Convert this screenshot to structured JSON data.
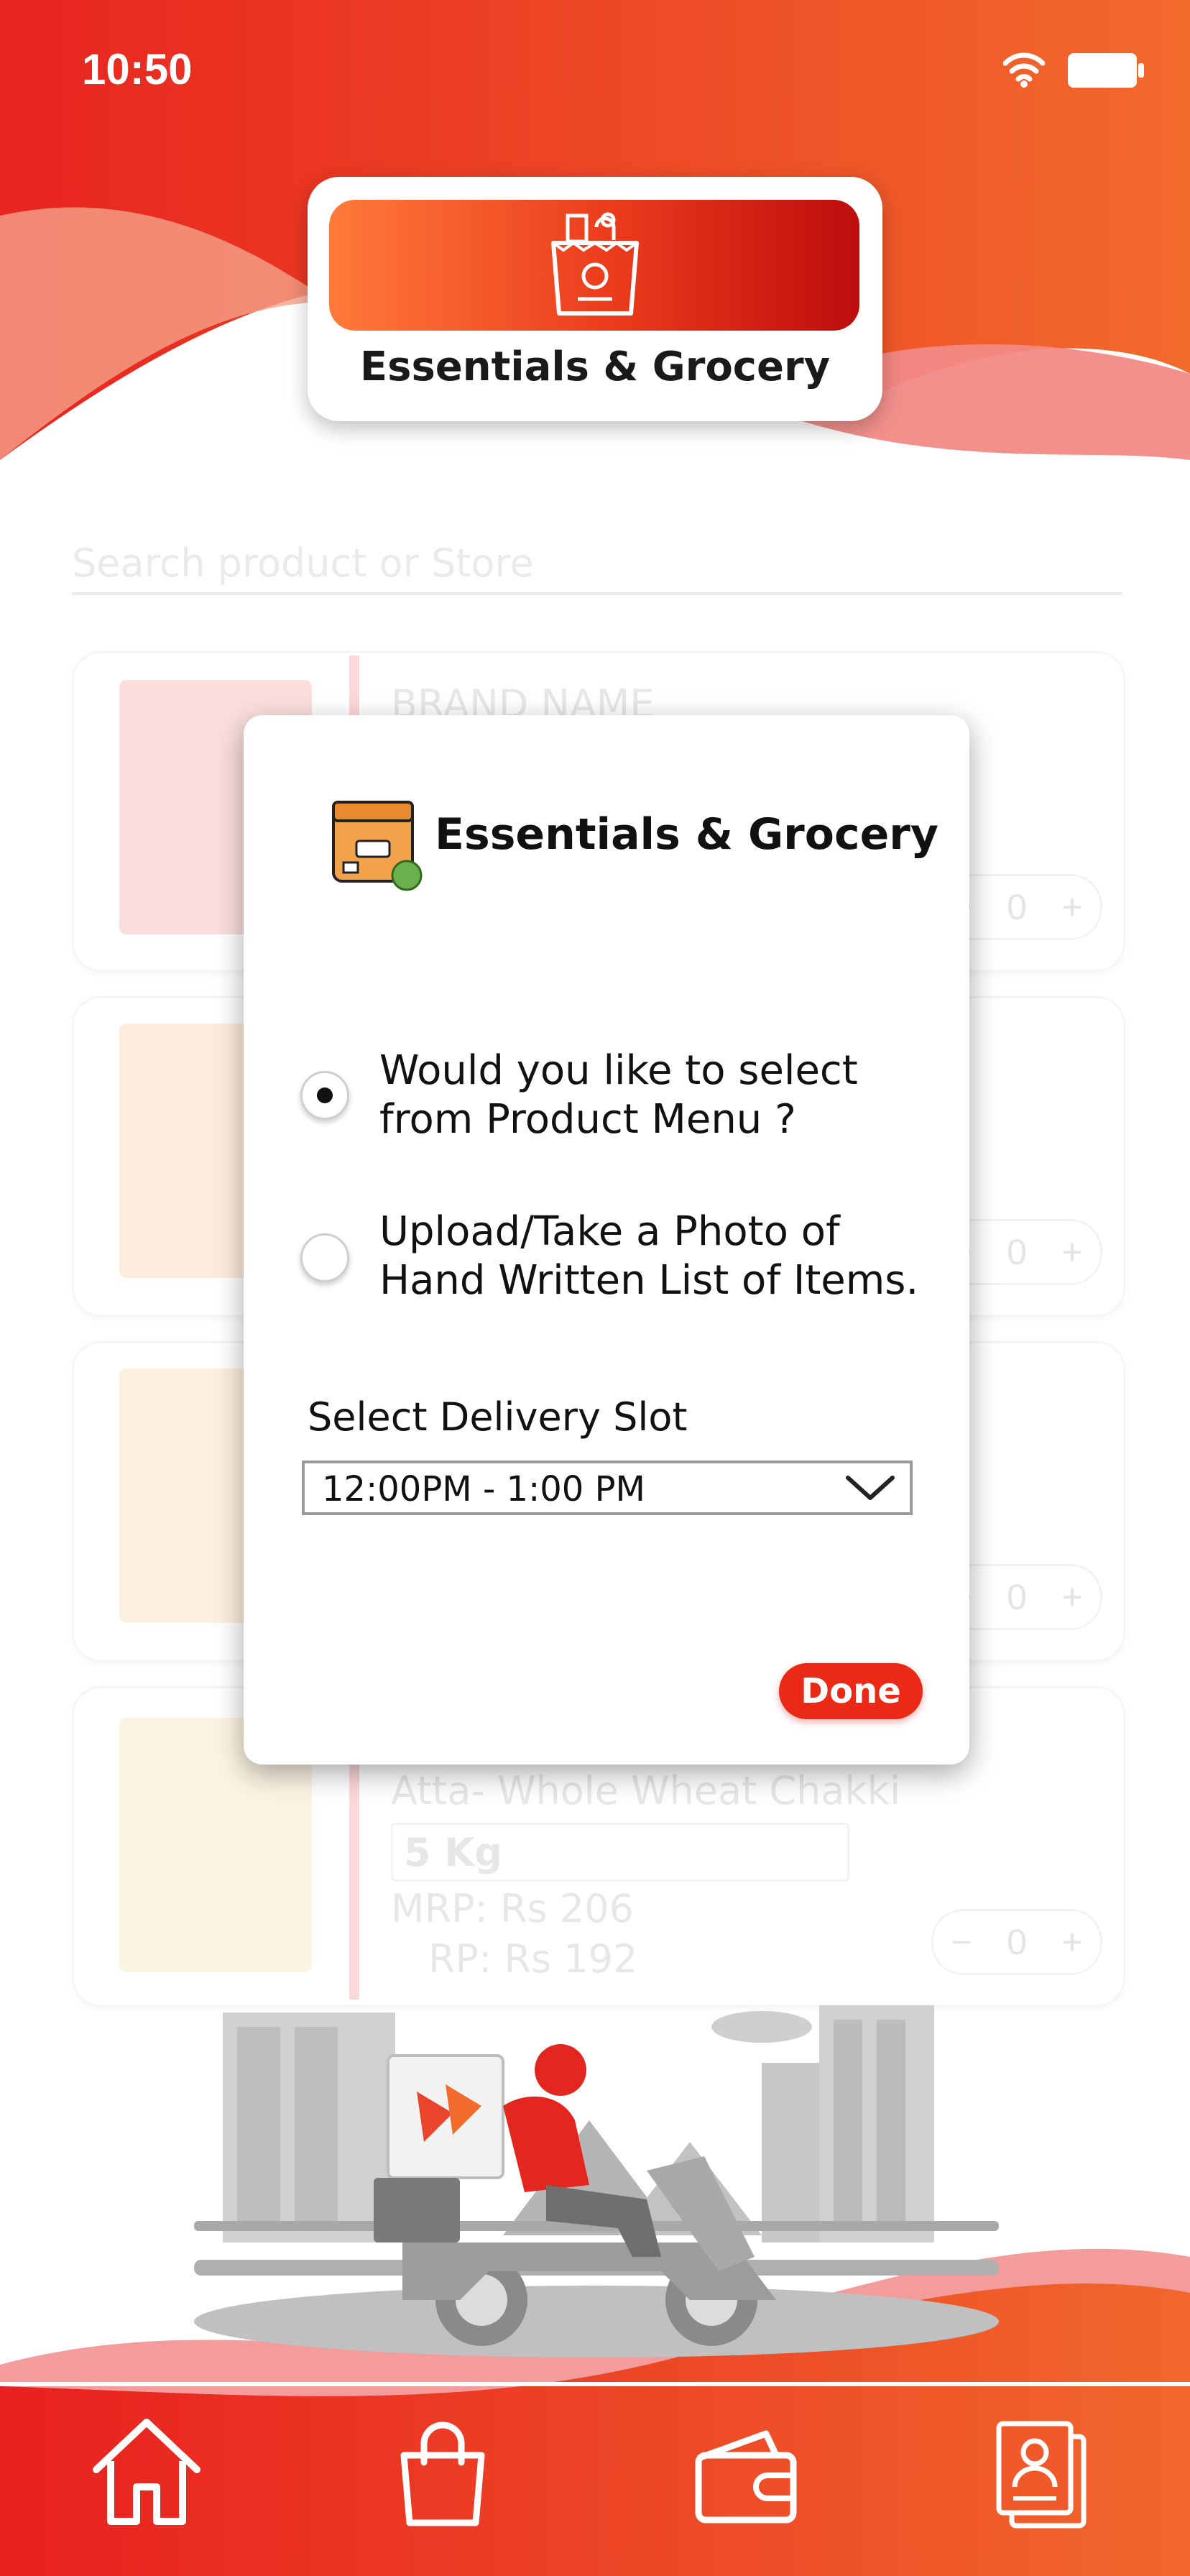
{
  "status_bar": {
    "time": "10:50"
  },
  "header": {
    "title": "Essentials & Grocery"
  },
  "background": {
    "search_placeholder": "Search product or Store",
    "products": [
      {
        "name": "BRAND NAME"
      },
      {
        "name": ""
      },
      {
        "name": ""
      },
      {
        "name": "Atta- Whole Wheat Chakki",
        "variant": "5 Kg",
        "mrp": "MRP: Rs 206",
        "rp": "RP: Rs 192"
      }
    ],
    "qty_minus": "−",
    "qty_value": "0",
    "qty_plus": "+"
  },
  "dialog": {
    "title": "Essentials & Grocery",
    "option1_line1": "Would you like to select",
    "option1_line2": "from Product Menu ?",
    "option2_line1": "Upload/Take a Photo of",
    "option2_line2": "Hand Written List of Items.",
    "selected_option": 1,
    "slot_label": "Select Delivery Slot",
    "slot_value": "12:00PM - 1:00 PM",
    "done_label": "Done"
  },
  "nav": {
    "items": [
      {
        "icon": "home-icon"
      },
      {
        "icon": "shopping-bag-icon"
      },
      {
        "icon": "wallet-icon"
      },
      {
        "icon": "profile-document-icon"
      }
    ]
  },
  "colors": {
    "primary": "#ea3a1c",
    "accent": "#ff7a3a",
    "dark_red": "#bd0d0d"
  }
}
